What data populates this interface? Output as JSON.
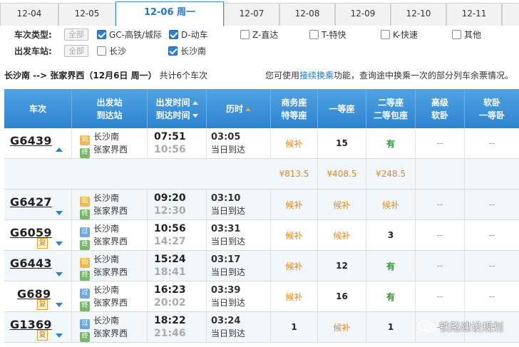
{
  "date_tabs": [
    {
      "label": "12-04",
      "active": false
    },
    {
      "label": "12-05",
      "active": false
    },
    {
      "label": "12-06 周一",
      "active": true
    },
    {
      "label": "12-07",
      "active": false
    },
    {
      "label": "12-08",
      "active": false
    },
    {
      "label": "12-09",
      "active": false
    },
    {
      "label": "12-10",
      "active": false
    },
    {
      "label": "12-11",
      "active": false
    }
  ],
  "filters": {
    "type_label": "车次类型:",
    "station_label": "出发车站:",
    "all_label": "全部",
    "types": [
      {
        "label": "GC-高铁/城际",
        "checked": true
      },
      {
        "label": "D-动车",
        "checked": true
      },
      {
        "label": "Z-直达",
        "checked": false
      },
      {
        "label": "T-特快",
        "checked": false
      },
      {
        "label": "K-快速",
        "checked": false
      },
      {
        "label": "其他",
        "checked": false
      }
    ],
    "stations": [
      {
        "label": "长沙",
        "checked": false
      },
      {
        "label": "长沙南",
        "checked": true
      }
    ]
  },
  "route": {
    "text": "长沙南 --> 张家界西（12月6日  周一）",
    "count_text": "共计6个车次"
  },
  "hint": {
    "prefix": "您可使用",
    "link": "接续换乘",
    "suffix": "功能，查询途中换乘一次的部分列车余票情况。"
  },
  "table": {
    "headers": [
      {
        "l1": "车次",
        "l2": ""
      },
      {
        "l1": "出发站",
        "l2": "到达站"
      },
      {
        "l1": "出发时间",
        "l2": "到达时间"
      },
      {
        "l1": "历时",
        "l2": ""
      },
      {
        "l1": "商务座",
        "l2": "特等座"
      },
      {
        "l1": "一等座",
        "l2": ""
      },
      {
        "l1": "二等座",
        "l2": "二等包座"
      },
      {
        "l1": "高级",
        "l2": "软卧"
      },
      {
        "l1": "软卧",
        "l2": "一等卧"
      }
    ],
    "badges": {
      "start": "始",
      "pass": "过",
      "end": "终",
      "fu": "复"
    },
    "arrive_same_day": "当日到达",
    "rows": [
      {
        "no": "G6439",
        "from_badge": "start",
        "from": "长沙南",
        "to": "张家界西",
        "dep": "07:51",
        "arr": "10:56",
        "dur": "03:05",
        "fu": false,
        "expanded": true,
        "seats": [
          "候补",
          "15",
          "有",
          "--",
          "--"
        ],
        "prices": [
          "¥813.5",
          "¥408.5",
          "¥248.5"
        ]
      },
      {
        "no": "G6427",
        "from_badge": "start",
        "from": "长沙南",
        "to": "张家界西",
        "dep": "09:20",
        "arr": "12:30",
        "dur": "03:10",
        "fu": false,
        "expanded": false,
        "seats": [
          "候补",
          "候补",
          "候补",
          "--",
          "--"
        ]
      },
      {
        "no": "G6059",
        "from_badge": "pass",
        "from": "长沙南",
        "to": "张家界西",
        "dep": "10:56",
        "arr": "14:27",
        "dur": "03:31",
        "fu": true,
        "expanded": false,
        "seats": [
          "候补",
          "候补",
          "3",
          "--",
          "--"
        ]
      },
      {
        "no": "G6443",
        "from_badge": "start",
        "from": "长沙南",
        "to": "张家界西",
        "dep": "15:24",
        "arr": "18:41",
        "dur": "03:17",
        "fu": false,
        "expanded": false,
        "seats": [
          "候补",
          "12",
          "有",
          "--",
          "--"
        ]
      },
      {
        "no": "G689",
        "from_badge": "pass",
        "from": "长沙南",
        "to": "张家界西",
        "dep": "16:23",
        "arr": "20:02",
        "dur": "03:39",
        "fu": true,
        "expanded": false,
        "seats": [
          "候补",
          "16",
          "有",
          "--",
          "--"
        ]
      },
      {
        "no": "G1369",
        "from_badge": "pass",
        "from": "长沙南",
        "to": "张家界西",
        "dep": "18:22",
        "arr": "21:46",
        "dur": "03:24",
        "fu": true,
        "expanded": false,
        "seats": [
          "1",
          "候补",
          "1",
          "--",
          "--"
        ]
      }
    ]
  },
  "watermark": "铁路建设规划",
  "colors": {
    "header_blue": "#2d83cf",
    "orange": "#e08a1a",
    "green": "#2a9a2a",
    "link": "#2378c7"
  }
}
